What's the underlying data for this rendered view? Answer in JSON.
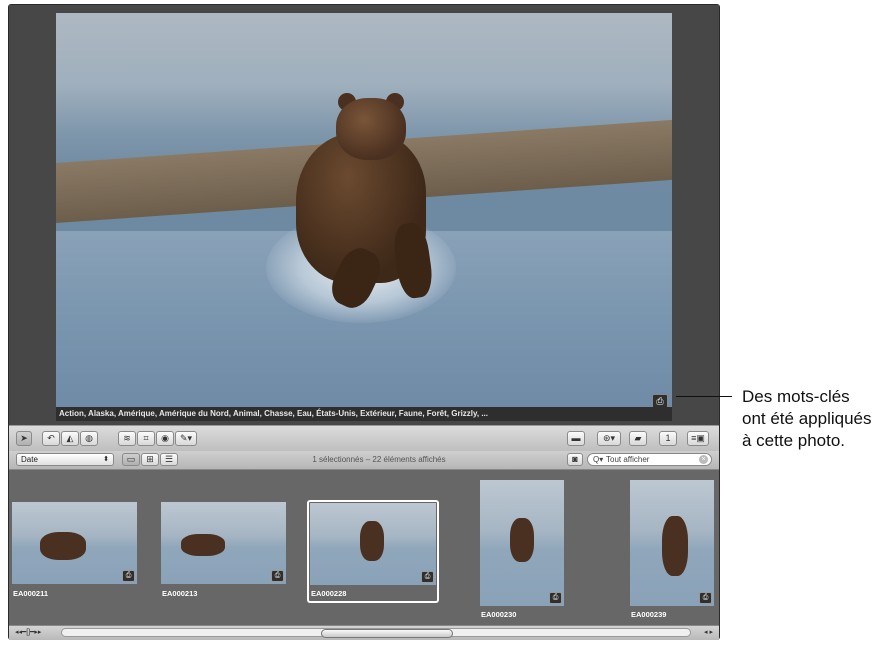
{
  "viewer": {
    "keywords": "Action, Alaska, Amérique, Amérique du Nord, Animal, Chasse, Eau, États-Unis, Extérieur, Faune, Forêt, Grizzly, ...",
    "badge_icon": "keyword-badge-icon"
  },
  "toolbar": {
    "left_tools": [
      "select-tool-icon",
      "rotate-icon",
      "straighten-icon",
      "lift-icon",
      "stamp-icon",
      "crop-icon",
      "redeye-icon",
      "brush-icon"
    ],
    "right_tools": [
      "vault-icon",
      "stack-icon",
      "keyword-icon",
      "number-icon",
      "view-icon"
    ]
  },
  "filterbar": {
    "sort_value": "Date",
    "status": "1 sélectionnés – 22 éléments affichés",
    "search_value": "Tout afficher"
  },
  "browser": {
    "thumbs": [
      {
        "label": "EA000211"
      },
      {
        "label": "EA000213"
      },
      {
        "label": "EA000228",
        "selected": true
      },
      {
        "label": "EA000230"
      },
      {
        "label": "EA000239"
      }
    ]
  },
  "callout": {
    "line1": "Des mots-clés",
    "line2": "ont été appliqués",
    "line3": "à cette photo."
  }
}
